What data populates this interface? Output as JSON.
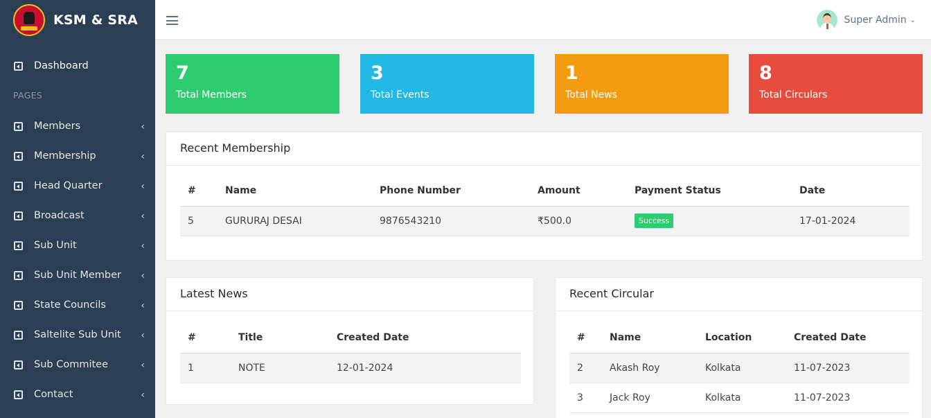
{
  "app": {
    "name": "KSM & SRA"
  },
  "sidebar": {
    "section_label": "PAGES",
    "items": [
      {
        "label": "Dashboard"
      },
      {
        "label": "Members"
      },
      {
        "label": "Membership"
      },
      {
        "label": "Head Quarter"
      },
      {
        "label": "Broadcast"
      },
      {
        "label": "Sub Unit"
      },
      {
        "label": "Sub Unit Member"
      },
      {
        "label": "State Councils"
      },
      {
        "label": "Saltelite Sub Unit"
      },
      {
        "label": "Sub Commitee"
      },
      {
        "label": "Contact"
      }
    ]
  },
  "topbar": {
    "user_name": "Super Admin"
  },
  "tiles": [
    {
      "value": "7",
      "label": "Total Members",
      "color": "#2ecc71"
    },
    {
      "value": "3",
      "label": "Total Events",
      "color": "#23b7e5"
    },
    {
      "value": "1",
      "label": "Total News",
      "color": "#f39c12"
    },
    {
      "value": "8",
      "label": "Total Circulars",
      "color": "#e74c3c"
    }
  ],
  "membership": {
    "title": "Recent Membership",
    "headers": [
      "#",
      "Name",
      "Phone Number",
      "Amount",
      "Payment Status",
      "Date"
    ],
    "rows": [
      {
        "id": "5",
        "name": "GURURAJ DESAI",
        "phone": "9876543210",
        "amount": "₹500.0",
        "status": "Success",
        "date": "17-01-2024"
      }
    ]
  },
  "news": {
    "title": "Latest News",
    "headers": [
      "#",
      "Title",
      "Created Date"
    ],
    "rows": [
      {
        "id": "1",
        "title": "NOTE",
        "date": "12-01-2024"
      }
    ]
  },
  "circular": {
    "title": "Recent Circular",
    "headers": [
      "#",
      "Name",
      "Location",
      "Created Date"
    ],
    "rows": [
      {
        "id": "2",
        "name": "Akash Roy",
        "location": "Kolkata",
        "date": "11-07-2023"
      },
      {
        "id": "3",
        "name": "Jack Roy",
        "location": "Kolkata",
        "date": "11-07-2023"
      }
    ]
  }
}
